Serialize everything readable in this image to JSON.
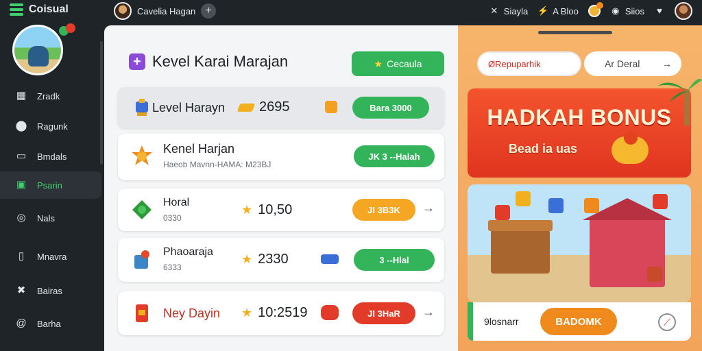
{
  "topbar": {
    "brand": "Coisual",
    "user_name": "Cavelia Hagan",
    "right_items": [
      {
        "icon": "bow-icon",
        "label": "Siayla"
      },
      {
        "icon": "bolt-icon",
        "label": "A Bloo"
      },
      {
        "icon": "coin-icon",
        "label": ""
      },
      {
        "icon": "globe-icon",
        "label": "Siios"
      },
      {
        "icon": "heart-icon",
        "label": ""
      }
    ]
  },
  "sidebar": {
    "items": [
      {
        "icon": "grid-icon",
        "label": "Zradk"
      },
      {
        "icon": "pin-icon",
        "label": "Ragunk"
      },
      {
        "icon": "card-icon",
        "label": "Bmdals"
      },
      {
        "icon": "square-icon",
        "label": "Psarin",
        "active": true
      },
      {
        "icon": "target-icon",
        "label": "Nals"
      },
      {
        "icon": "doc-icon",
        "label": "Mnavra"
      },
      {
        "icon": "x-icon",
        "label": "Bairas"
      },
      {
        "icon": "at-icon",
        "label": "Barha"
      }
    ],
    "accent": "#3fcf6f"
  },
  "main": {
    "title": "Kevel Karai Marajan",
    "top_button": "Cecaula",
    "rows": [
      {
        "name": "Level Harayn",
        "sub": "",
        "score": "2695",
        "button": "Bara 3000",
        "style": "green"
      },
      {
        "name": "Kenel Harjan",
        "sub": "Haeob Mavnn-HAMA: M23BJ",
        "score": "",
        "button": "JK 3 --Halah",
        "style": "green"
      },
      {
        "name": "Horal",
        "sub": "0330",
        "score": "10,50",
        "button": "JI 3B3K",
        "style": "orange"
      },
      {
        "name": "Phaoaraja",
        "sub": "6333",
        "score": "2330",
        "button": "3 --Hlal",
        "style": "green"
      },
      {
        "name": "Ney Dayin",
        "sub": "",
        "score": "10:2519",
        "button": "JI 3HaR",
        "style": "red"
      }
    ]
  },
  "right": {
    "input_left": "ØRepuparhik",
    "input_right": "Ar Deral",
    "bonus_title": "HADKAH BONUS",
    "bonus_sub": "Bead ia uas",
    "footer_label": "9losnarr",
    "footer_button": "BADOMK"
  },
  "colors": {
    "green": "#33b35a",
    "orange": "#f5a623",
    "red": "#e23b2a",
    "panel_orange": "#f6b46a"
  }
}
